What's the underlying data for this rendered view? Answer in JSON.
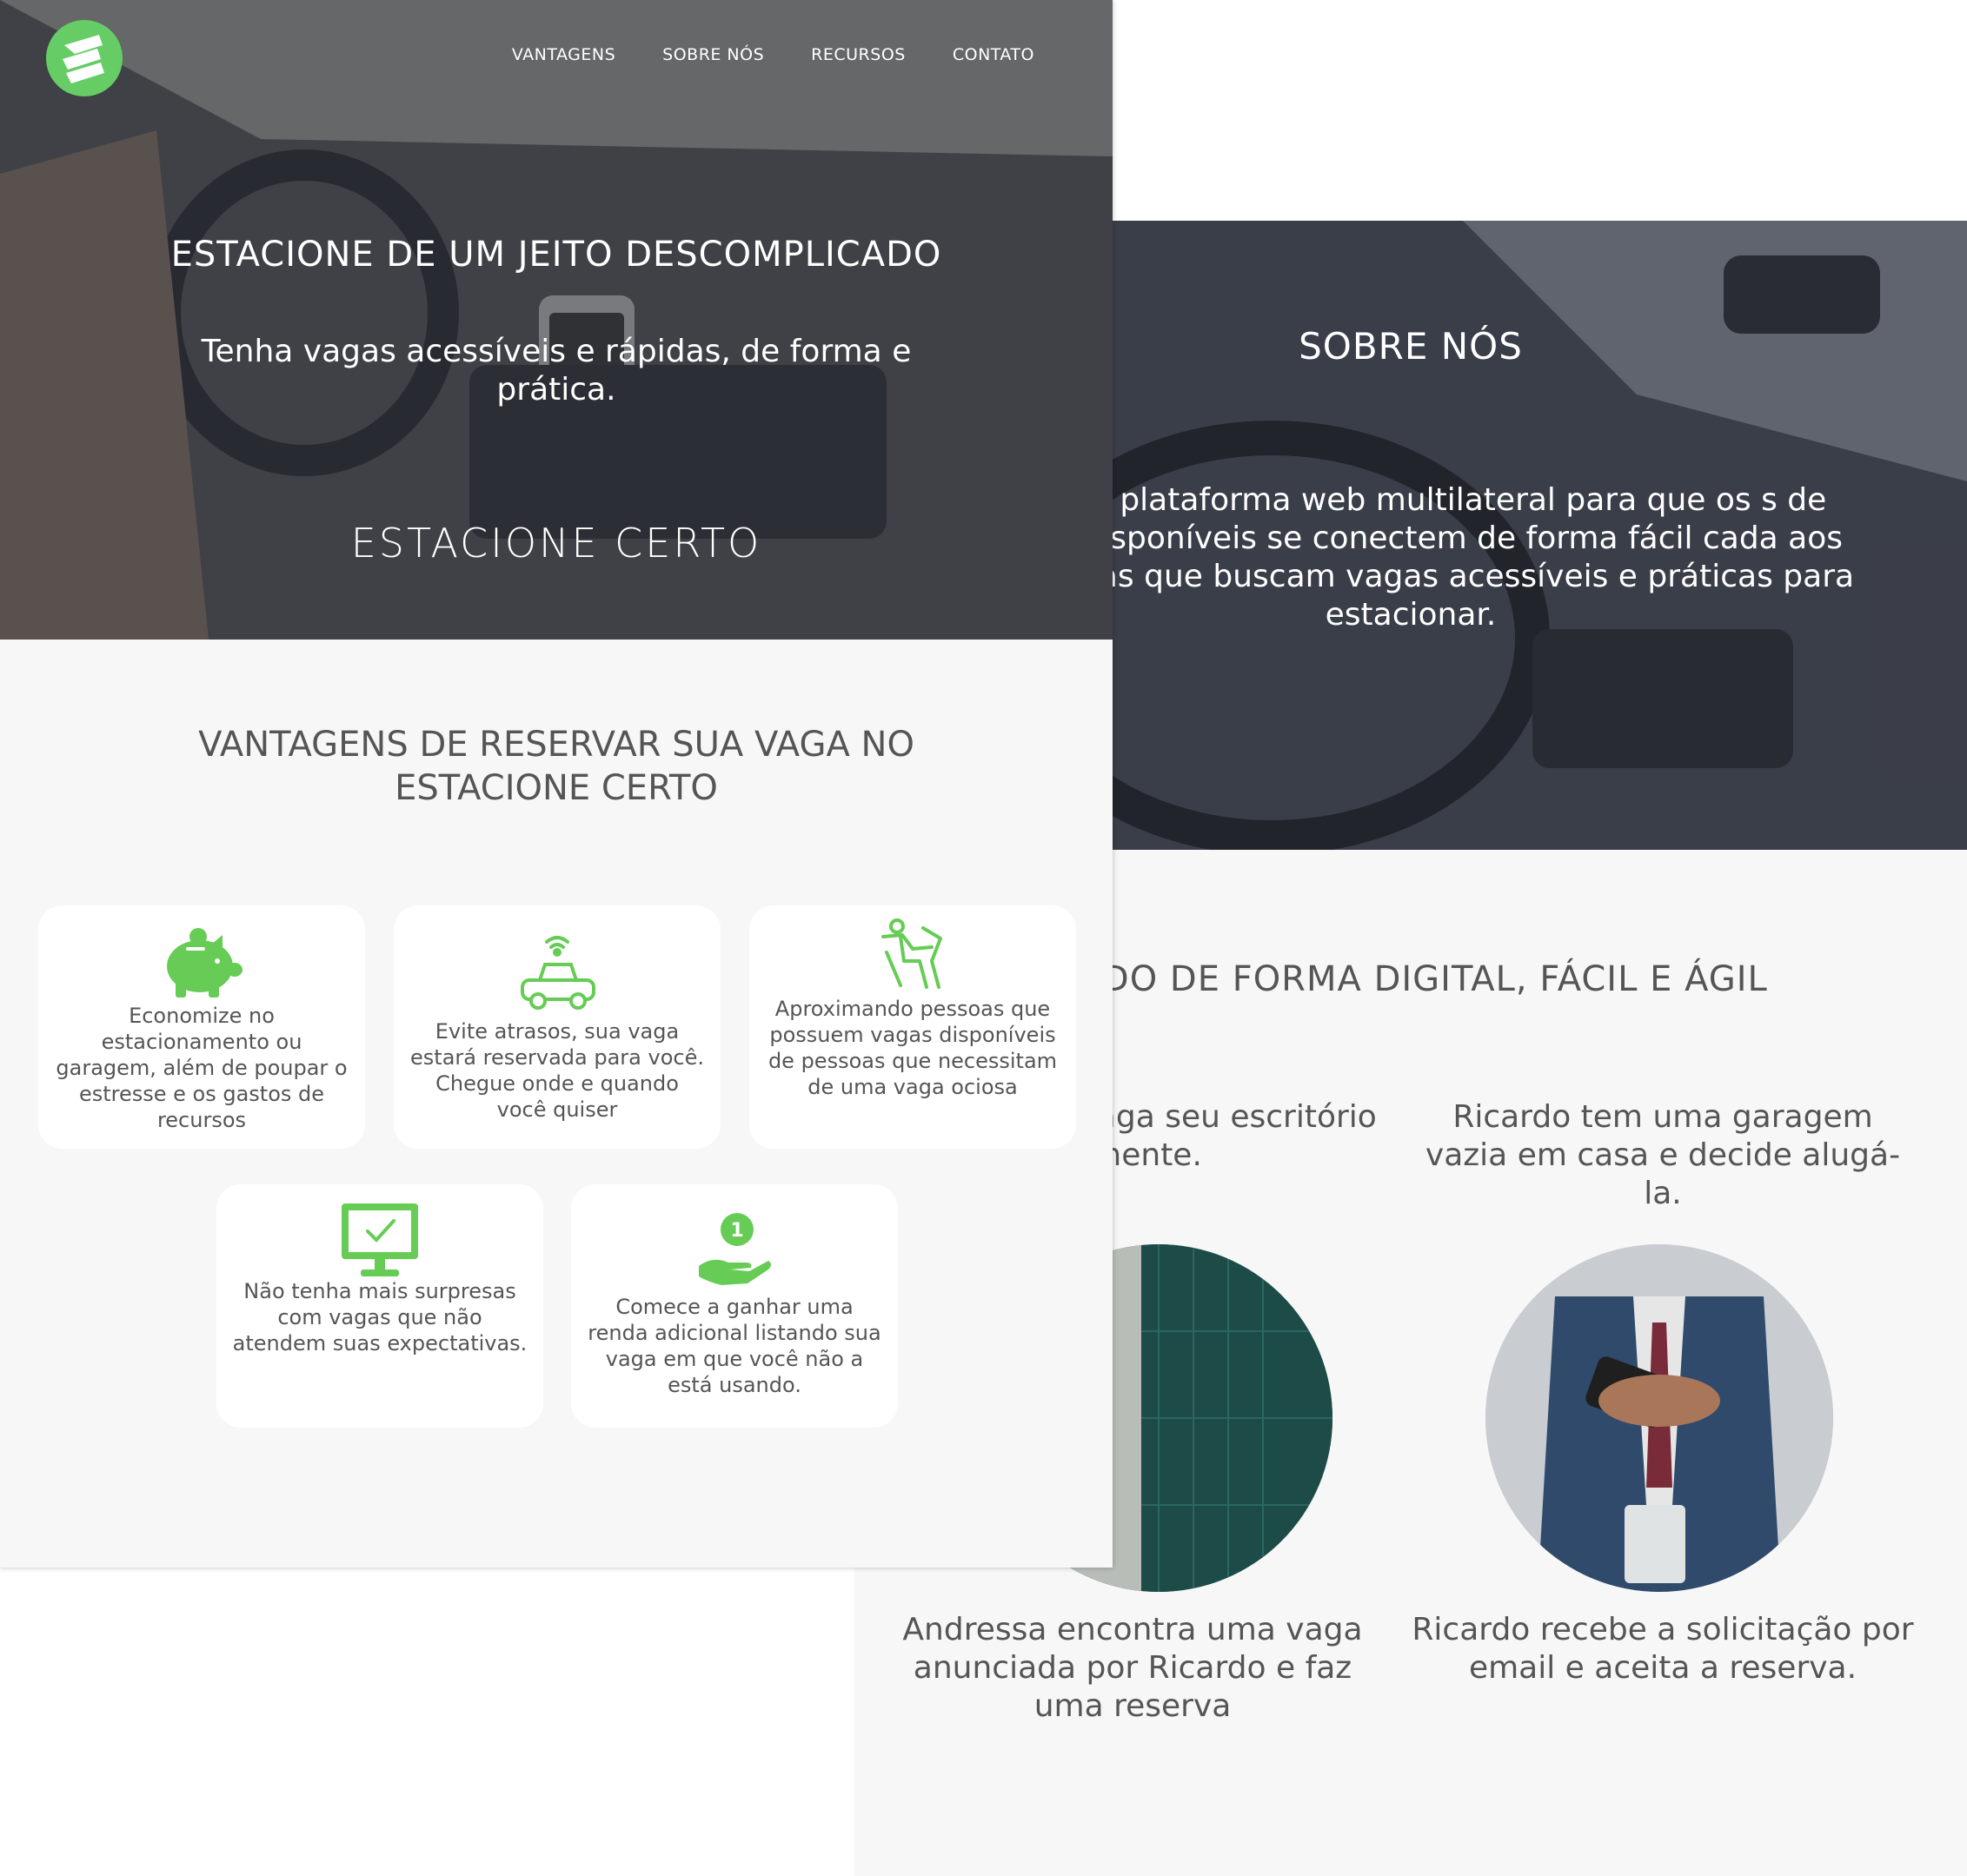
{
  "colors": {
    "accent": "#66cc55",
    "text": "#555555",
    "background": "#f7f7f7"
  },
  "nav": {
    "items": [
      {
        "label": "VANTAGENS"
      },
      {
        "label": "SOBRE NÓS"
      },
      {
        "label": "RECURSOS"
      },
      {
        "label": "CONTATO"
      }
    ]
  },
  "hero": {
    "title": "ESTACIONE DE UM JEITO DESCOMPLICADO",
    "subtitle": "Tenha vagas acessíveis e rápidas, de forma e prática.",
    "brand": "ESTACIONE CERTO"
  },
  "advantages": {
    "title": "VANTAGENS DE RESERVAR SUA VAGA NO ESTACIONE CERTO",
    "cards": [
      {
        "icon": "piggy-bank-icon",
        "text": "Economize no estacionamento ou garagem, além de poupar o estresse e os gastos de recursos"
      },
      {
        "icon": "connected-car-icon",
        "text": "Evite atrasos, sua vaga estará reservada para você. Chegue onde e quando você quiser"
      },
      {
        "icon": "seated-person-icon",
        "text": "Aproximando pessoas que possuem vagas disponíveis de pessoas que necessitam de uma vaga ociosa"
      },
      {
        "icon": "monitor-check-icon",
        "text": "Não tenha mais surpresas com vagas que não atendem suas expectativas."
      },
      {
        "icon": "hand-coin-icon",
        "text": "Comece a ganhar uma renda adicional listando sua vaga em que você não a está usando."
      }
    ]
  },
  "about": {
    "title": "SOBRE NÓS",
    "text": "os uma plataforma web multilateral para que os s de vagas disponíveis se conectem de forma fácil cada aos motoristas que buscam vagas acessíveis e práticas para estacionar."
  },
  "digital": {
    "title": "TUDO DE FORMA DIGITAL, FÁCIL E ÁGIL",
    "stories": [
      {
        "text": "rocura uma vaga seu escritório iamente."
      },
      {
        "text": "Ricardo tem uma garagem vazia em casa e decide alugá-la."
      },
      {
        "text": "Andressa encontra uma vaga anunciada por Ricardo e faz uma reserva"
      },
      {
        "text": "Ricardo recebe a solicitação por email e aceita a reserva."
      }
    ]
  }
}
